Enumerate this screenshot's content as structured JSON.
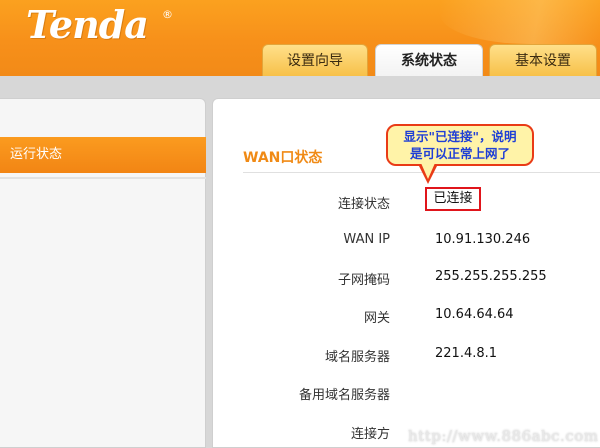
{
  "brand": {
    "logo_text": "Tenda",
    "reg_mark": "®"
  },
  "tabs": [
    {
      "label": "设置向导",
      "active": false
    },
    {
      "label": "系统状态",
      "active": true
    },
    {
      "label": "基本设置",
      "active": false
    }
  ],
  "sidebar": {
    "items": [
      {
        "label": "运行状态",
        "active": true
      }
    ]
  },
  "main": {
    "section_title": "WAN口状态",
    "rows": [
      {
        "label": "连接状态",
        "value": "已连接"
      },
      {
        "label": "WAN IP",
        "value": "10.91.130.246"
      },
      {
        "label": "子网掩码",
        "value": "255.255.255.255"
      },
      {
        "label": "网关",
        "value": "10.64.64.64"
      },
      {
        "label": "域名服务器",
        "value": "221.4.8.1"
      },
      {
        "label": "备用域名服务器",
        "value": ""
      },
      {
        "label": "连接方",
        "value": ""
      }
    ]
  },
  "annotation": {
    "line1": "显示\"已连接\"，说明",
    "line2": "是可以正常上网了"
  },
  "watermark": "http://www.886abc.com",
  "colors": {
    "accent": "#f7901a",
    "highlight_border": "#e0151b",
    "callout_text": "#1f3fd6"
  }
}
